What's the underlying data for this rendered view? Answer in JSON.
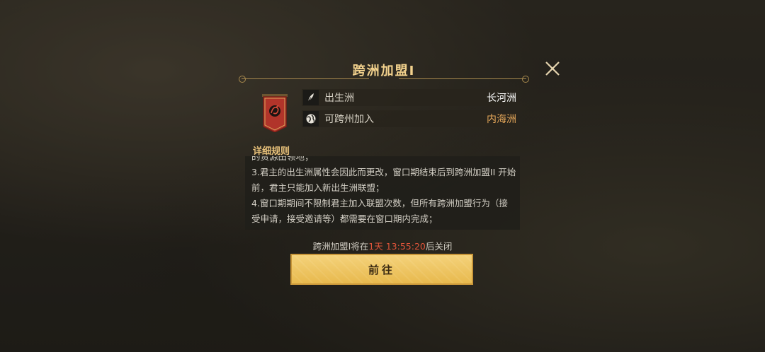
{
  "dialog": {
    "title": "跨洲加盟I",
    "close_icon": "close-icon"
  },
  "alliance_banner": {
    "icon": "dragon-banner-icon",
    "color": "#b1342a"
  },
  "info": [
    {
      "icon": "feather-icon",
      "label": "出生洲",
      "value": "长河洲",
      "value_color": "#ffffff"
    },
    {
      "icon": "globe-icon",
      "label": "可跨州加入",
      "value": "内海洲",
      "value_color": "#e6a85a"
    }
  ],
  "rules": {
    "heading": "详细规则",
    "lines": [
      "的资源田领地；",
      "3.君主的出生洲属性会因此而更改，窗口期结束后到跨洲加盟II 开始前，君主只能加入新出生洲联盟；",
      "4.窗口期期间不限制君主加入联盟次数，但所有跨洲加盟行为（接受申请，接受邀请等）都需要在窗口期内完成；"
    ]
  },
  "countdown": {
    "prefix": "跨洲加盟I将在",
    "time": "1天 13:55:20",
    "suffix": "后关闭"
  },
  "go_button": {
    "label": "前往"
  }
}
